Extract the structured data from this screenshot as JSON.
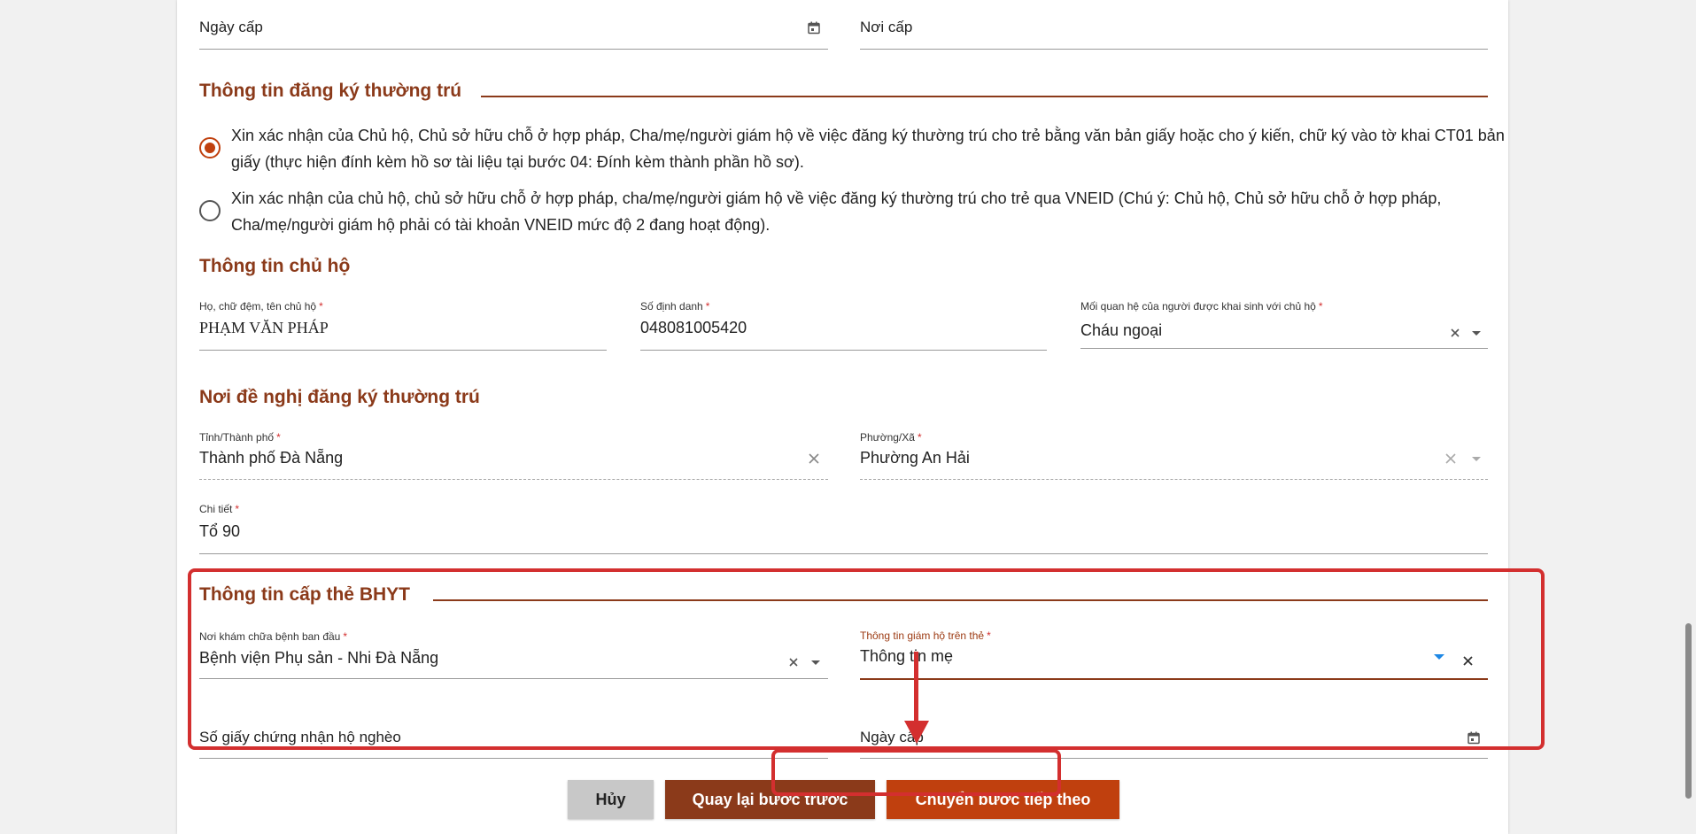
{
  "top_fields": {
    "issue_date_label": "Ngày cấp",
    "issue_place_label": "Nơi cấp"
  },
  "residence_registration": {
    "title": "Thông tin đăng ký thường trú",
    "option1": "Xin xác nhận của Chủ hộ, Chủ sở hữu chỗ ở hợp pháp, Cha/mẹ/người giám hộ về việc đăng ký thường trú cho trẻ bằng văn bản giấy hoặc cho ý kiến, chữ ký vào tờ khai CT01 bản giấy (thực hiện đính kèm hồ sơ tài liệu tại bước 04: Đính kèm thành phần hồ sơ).",
    "option2": "Xin xác nhận của chủ hộ, chủ sở hữu chỗ ở hợp pháp, cha/mẹ/người giám hộ về việc đăng ký thường trú cho trẻ qua VNEID (Chú ý: Chủ hộ, Chủ sở hữu chỗ ở hợp pháp, Cha/mẹ/người giám hộ phải có tài khoản VNEID mức độ 2 đang hoạt động).",
    "selected_option": 1
  },
  "household_head": {
    "title": "Thông tin chủ hộ",
    "name_label": "Họ, chữ đệm, tên chủ hộ",
    "name_value": "PHẠM VĂN PHÁP",
    "id_label": "Số định danh",
    "id_value": "048081005420",
    "relation_label": "Mối quan hệ của người được khai sinh với chủ hộ",
    "relation_value": "Cháu ngoại",
    "required_mark": "*"
  },
  "proposed_place": {
    "title": "Nơi đề nghị đăng ký thường trú",
    "province_label": "Tỉnh/Thành phố",
    "province_value": "Thành phố Đà Nẵng",
    "ward_label": "Phường/Xã",
    "ward_value": "Phường An Hải",
    "detail_label": "Chi tiết",
    "detail_value": "Tổ 90"
  },
  "health_insurance": {
    "title": "Thông tin cấp thẻ BHYT",
    "hospital_label": "Nơi khám chữa bệnh ban đầu",
    "hospital_value": "Bệnh viện Phụ sản - Nhi Đà Nẵng",
    "guardian_label": "Thông tin giám hộ trên thẻ",
    "guardian_value": "Thông tin mẹ",
    "poverty_cert_label": "Số giấy chứng nhận hộ nghèo",
    "issue_date_label": "Ngày cấp"
  },
  "actions": {
    "cancel": "Hủy",
    "back": "Quay lại bước trước",
    "next": "Chuyển bước tiếp theo"
  },
  "colors": {
    "brand": "#8b3a1a",
    "next_button": "#c0400e",
    "annotation": "#d32f2f"
  }
}
